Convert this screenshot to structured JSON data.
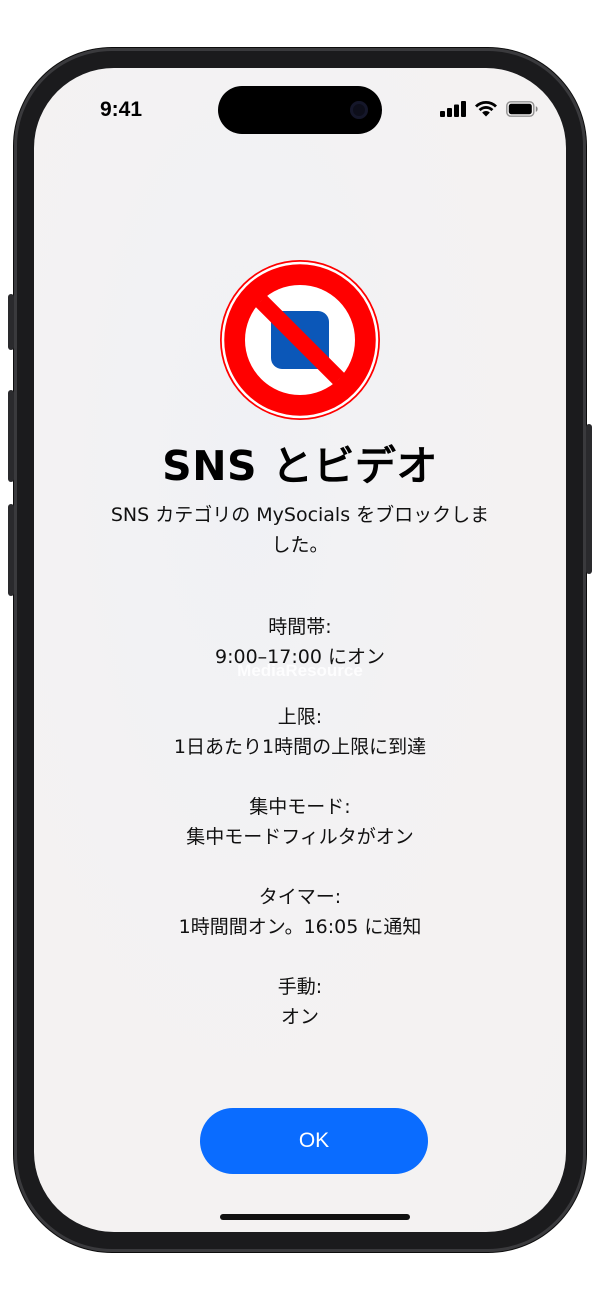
{
  "status_bar": {
    "time": "9:41",
    "icons": [
      "cellular-signal-icon",
      "wifi-icon",
      "battery-icon"
    ]
  },
  "alert": {
    "icon": "blocked-app-icon",
    "title": "SNS とビデオ",
    "message": "SNS カテゴリの MySocials をブロックしました。",
    "reasons": [
      {
        "label": "時間帯:",
        "value": "9:00–17:00 にオン"
      },
      {
        "label": "上限:",
        "value": "1日あたり1時間の上限に到達"
      },
      {
        "label": "集中モード:",
        "value": "集中モードフィルタがオン"
      },
      {
        "label": "タイマー:",
        "value": "1時間間オン。16:05 に通知"
      },
      {
        "label": "手動:",
        "value": "オン"
      }
    ],
    "ok_label": "OK"
  },
  "watermark": "MediaResource",
  "colors": {
    "accent": "#0a6cff",
    "block_red": "#ff0000",
    "app_blue": "#0b57b8"
  }
}
